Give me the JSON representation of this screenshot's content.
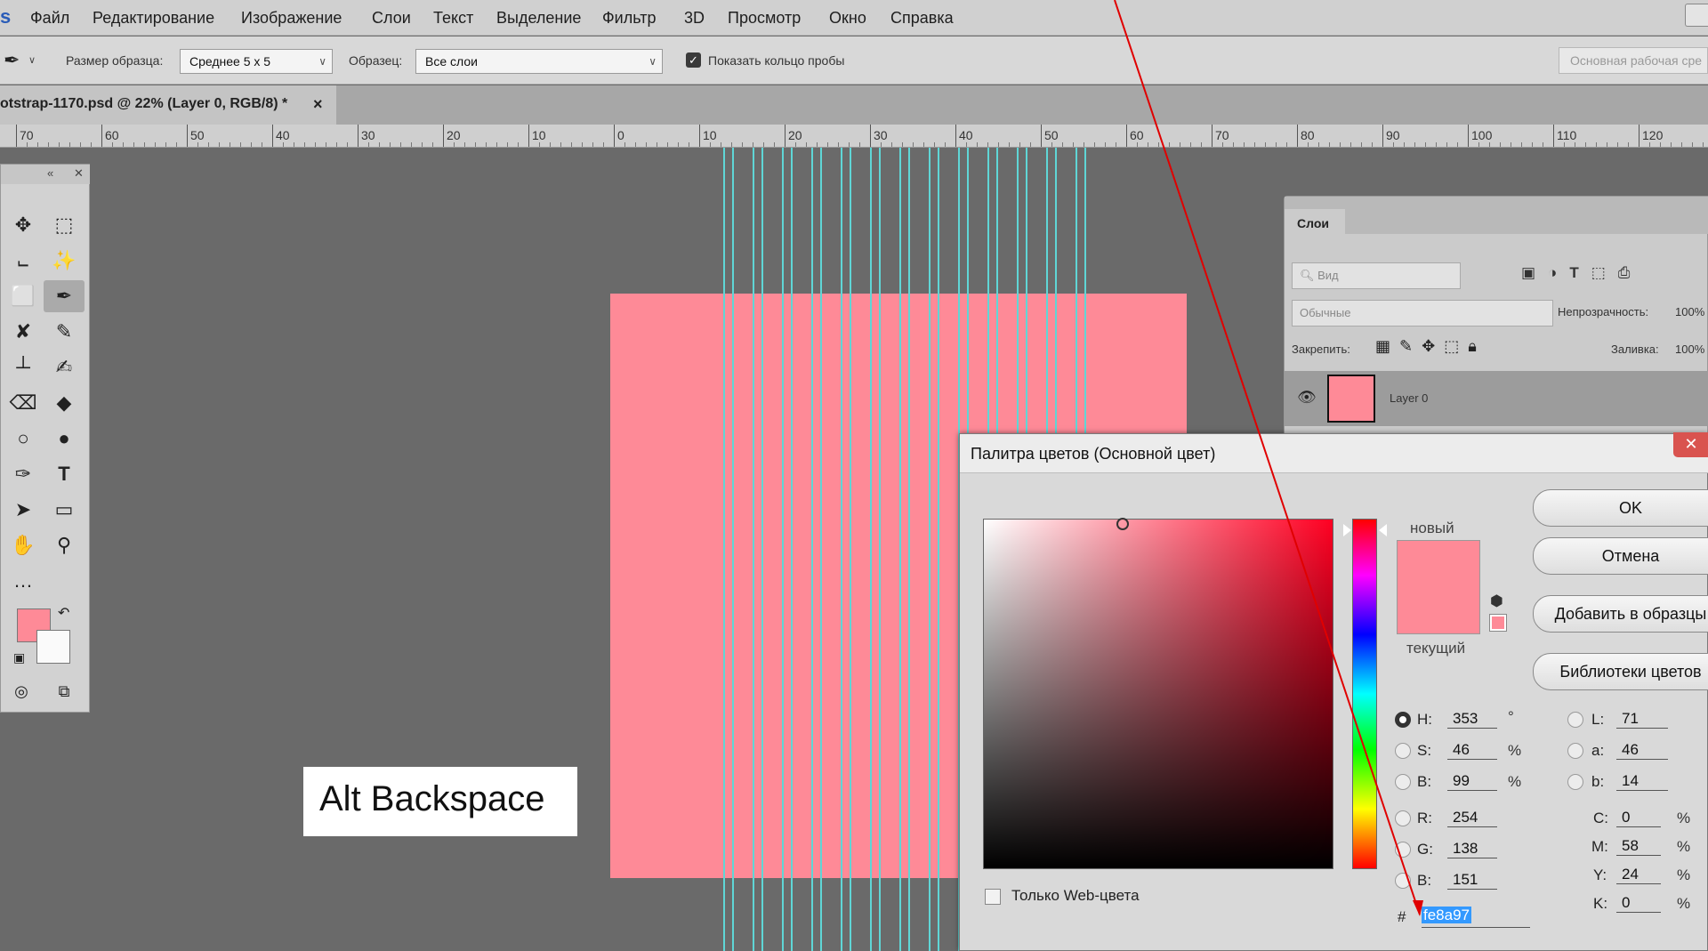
{
  "menu": {
    "items": [
      "Файл",
      "Редактирование",
      "Изображение",
      "Слои",
      "Текст",
      "Выделение",
      "Фильтр",
      "3D",
      "Просмотр",
      "Окно",
      "Справка"
    ]
  },
  "options": {
    "sample_size_label": "Размер образца:",
    "sample_size_value": "Среднее 5 x 5",
    "sample_label": "Образец:",
    "sample_value": "Все слои",
    "show_ring_label": "Показать кольцо пробы",
    "workspace": "Основная рабочая сре"
  },
  "tab": {
    "title": "otstrap-1170.psd @ 22% (Layer 0, RGB/8) *",
    "close": "×"
  },
  "ruler": {
    "labels": [
      "70",
      "60",
      "50",
      "40",
      "30",
      "20",
      "10",
      "0",
      "10",
      "20",
      "30",
      "40",
      "50",
      "60",
      "70",
      "80",
      "90",
      "100",
      "110",
      "120"
    ]
  },
  "colors": {
    "foreground": "#fe8a97",
    "background": "#fafafa",
    "guide": "#5fd6d6",
    "annotation_line": "#e00000"
  },
  "layers": {
    "tab": "Слои",
    "filter_placeholder": "Вид",
    "blend_mode": "Обычные",
    "opacity_label": "Непрозрачность:",
    "opacity_value": "100%",
    "lock_label": "Закрепить:",
    "fill_label": "Заливка:",
    "fill_value": "100%",
    "layer_name": "Layer 0"
  },
  "picker": {
    "title": "Палитра цветов (Основной цвет)",
    "new_label": "новый",
    "current_label": "текущий",
    "buttons": {
      "ok": "OK",
      "cancel": "Отмена",
      "add_swatch": "Добавить в образцы",
      "libraries": "Библиотеки цветов"
    },
    "hsb": {
      "h": "353",
      "s": "46",
      "b": "99",
      "h_unit": "°",
      "s_unit": "%",
      "b_unit": "%"
    },
    "rgb": {
      "r": "254",
      "g": "138",
      "b": "151"
    },
    "lab": {
      "l": "71",
      "a": "46",
      "b": "14"
    },
    "cmyk": {
      "c": "0",
      "m": "58",
      "y": "24",
      "k": "0",
      "unit": "%"
    },
    "web_only_label": "Только Web-цвета",
    "hex_symbol": "#",
    "hex": "fe8a97",
    "field_keys": {
      "h": "H:",
      "s": "S:",
      "b": "B:",
      "r": "R:",
      "g": "G:",
      "b2": "B:",
      "l": "L:",
      "a": "a:",
      "lab_b": "b:",
      "c": "C:",
      "m": "M:",
      "y": "Y:",
      "k": "K:"
    }
  },
  "hint": "Alt Backspace"
}
